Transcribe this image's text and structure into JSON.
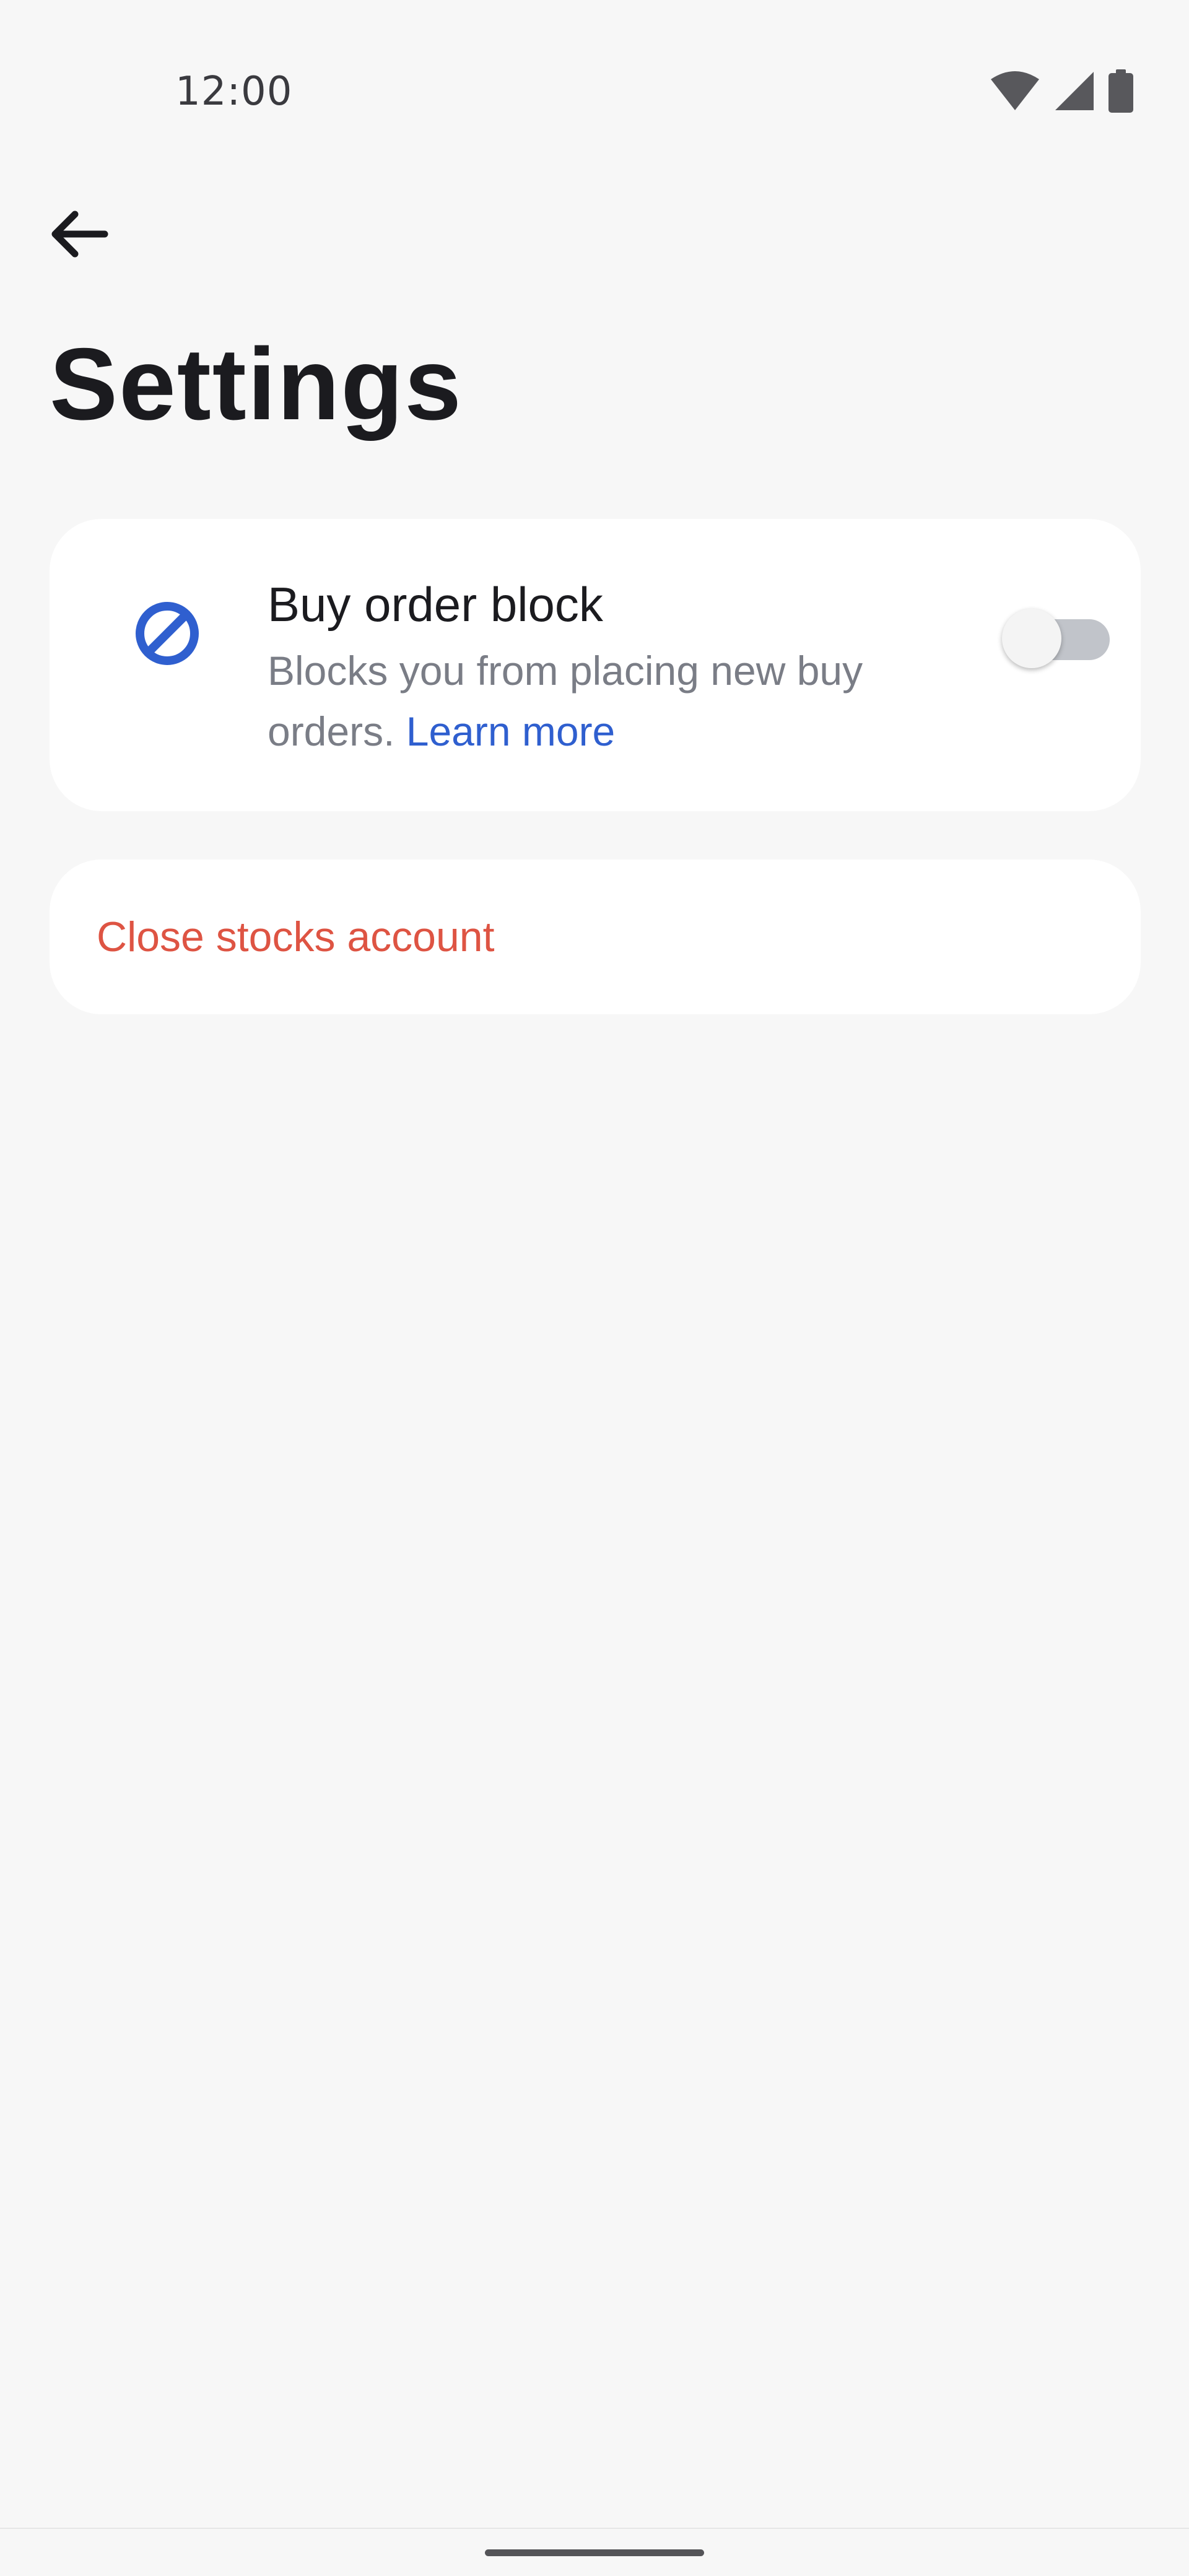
{
  "status_bar": {
    "time": "12:00",
    "icons": [
      "wifi-icon",
      "cell-signal-icon",
      "battery-icon"
    ]
  },
  "header": {
    "back_icon": "arrow-back-icon",
    "title": "Settings"
  },
  "settings": {
    "buy_order_block": {
      "icon": "block-icon",
      "title": "Buy order block",
      "description": "Blocks you from placing new buy orders.",
      "link": "Learn more",
      "enabled": false
    },
    "close_account": {
      "label": "Close stocks account"
    }
  },
  "colors": {
    "background": "#f7f7f7",
    "card": "#ffffff",
    "accent_blue": "#2f5fcf",
    "danger_red": "#de5443",
    "toggle_track_off": "#c1c4ca"
  }
}
